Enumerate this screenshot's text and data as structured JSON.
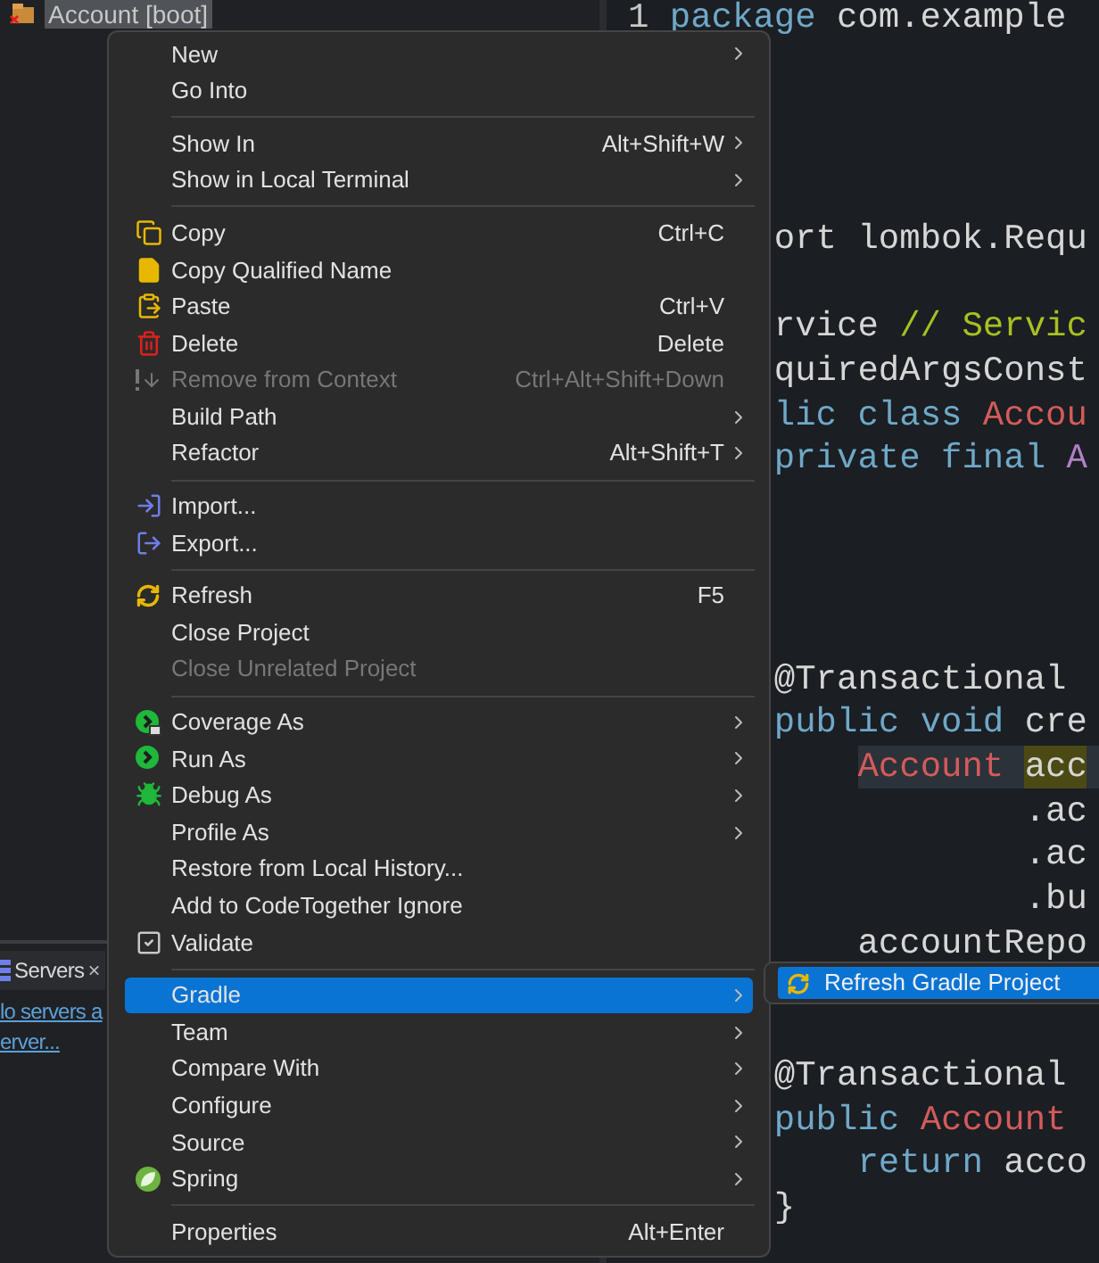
{
  "project_explorer": {
    "items": [
      {
        "label": "Account [boot]",
        "selected": true
      }
    ]
  },
  "servers_view": {
    "tab": {
      "label": "Servers",
      "close": "×"
    },
    "links": [
      "lo servers a",
      "erver..."
    ]
  },
  "editor": {
    "lines": [
      {
        "current": false,
        "segments": [
          {
            "text": "1 ",
            "kind": "linenum"
          },
          {
            "text": "package",
            "kind": "keyword"
          },
          {
            "text": " com.example",
            "kind": "plain"
          }
        ]
      },
      {
        "current": false,
        "segments": [
          {
            "text": "ort lombok.Requ",
            "kind": "plain"
          }
        ]
      },
      {
        "current": false,
        "segments": [
          {
            "text": "rvice ",
            "kind": "plain"
          },
          {
            "text": "// Servic",
            "kind": "comment"
          }
        ]
      },
      {
        "current": false,
        "segments": [
          {
            "text": "quiredArgsConst",
            "kind": "plain"
          }
        ]
      },
      {
        "current": false,
        "segments": [
          {
            "text": "lic class ",
            "kind": "keyword"
          },
          {
            "text": "Accou",
            "kind": "type"
          }
        ]
      },
      {
        "current": false,
        "segments": [
          {
            "text": "private final ",
            "kind": "keyword"
          },
          {
            "text": "A",
            "kind": "field"
          }
        ]
      },
      {
        "current": false,
        "segments": [
          {
            "text": "@Transactional",
            "kind": "plain"
          }
        ]
      },
      {
        "current": false,
        "segments": [
          {
            "text": "public void ",
            "kind": "keyword"
          },
          {
            "text": "cre",
            "kind": "plain"
          }
        ]
      },
      {
        "current": true,
        "segments": [
          {
            "text": "Account",
            "kind": "type"
          },
          {
            "text": "acc",
            "kind": "occurrence"
          }
        ]
      },
      {
        "current": false,
        "segments": [
          {
            "text": ".ac",
            "kind": "plain"
          }
        ]
      },
      {
        "current": false,
        "segments": [
          {
            "text": ".ac",
            "kind": "plain"
          }
        ]
      },
      {
        "current": false,
        "segments": [
          {
            "text": ".bu",
            "kind": "plain"
          }
        ]
      },
      {
        "current": false,
        "segments": [
          {
            "text": "accountRepo",
            "kind": "plain"
          }
        ]
      },
      {
        "current": false,
        "segments": [
          {
            "text": "@Transactional",
            "kind": "plain"
          }
        ]
      },
      {
        "current": false,
        "segments": [
          {
            "text": "public ",
            "kind": "keyword"
          },
          {
            "text": "Account",
            "kind": "type"
          }
        ]
      },
      {
        "current": false,
        "segments": [
          {
            "text": "return",
            "kind": "keyword"
          },
          {
            "text": "acco",
            "kind": "plain"
          }
        ]
      },
      {
        "current": false,
        "segments": [
          {
            "text": "}",
            "kind": "plain"
          }
        ]
      }
    ]
  },
  "context_menu": {
    "items": [
      {
        "kind": "item",
        "label": "New",
        "submenu": true,
        "disabled": false,
        "selected": false
      },
      {
        "kind": "item",
        "label": "Go Into",
        "submenu": false,
        "disabled": false,
        "selected": false
      },
      {
        "kind": "separator"
      },
      {
        "kind": "item",
        "label": "Show In",
        "shortcut": "Alt+Shift+W",
        "submenu": true,
        "disabled": false,
        "selected": false
      },
      {
        "kind": "item",
        "label": "Show in Local Terminal",
        "submenu": true,
        "disabled": false,
        "selected": false
      },
      {
        "kind": "separator"
      },
      {
        "kind": "item",
        "label": "Copy",
        "shortcut": "Ctrl+C",
        "submenu": false,
        "disabled": false,
        "selected": false
      },
      {
        "kind": "item",
        "label": "Copy Qualified Name",
        "submenu": false,
        "disabled": false,
        "selected": false
      },
      {
        "kind": "item",
        "label": "Paste",
        "shortcut": "Ctrl+V",
        "submenu": false,
        "disabled": false,
        "selected": false
      },
      {
        "kind": "item",
        "label": "Delete",
        "shortcut": "Delete",
        "submenu": false,
        "disabled": false,
        "selected": false
      },
      {
        "kind": "item",
        "label": "Remove from Context",
        "shortcut": "Ctrl+Alt+Shift+Down",
        "submenu": false,
        "disabled": true,
        "selected": false
      },
      {
        "kind": "item",
        "label": "Build Path",
        "submenu": true,
        "disabled": false,
        "selected": false
      },
      {
        "kind": "item",
        "label": "Refactor",
        "shortcut": "Alt+Shift+T",
        "submenu": true,
        "disabled": false,
        "selected": false
      },
      {
        "kind": "separator"
      },
      {
        "kind": "item",
        "label": "Import...",
        "submenu": false,
        "disabled": false,
        "selected": false
      },
      {
        "kind": "item",
        "label": "Export...",
        "submenu": false,
        "disabled": false,
        "selected": false
      },
      {
        "kind": "separator"
      },
      {
        "kind": "item",
        "label": "Refresh",
        "shortcut": "F5",
        "submenu": false,
        "disabled": false,
        "selected": false
      },
      {
        "kind": "item",
        "label": "Close Project",
        "submenu": false,
        "disabled": false,
        "selected": false
      },
      {
        "kind": "item",
        "label": "Close Unrelated Project",
        "submenu": false,
        "disabled": true,
        "selected": false
      },
      {
        "kind": "separator"
      },
      {
        "kind": "item",
        "label": "Coverage As",
        "submenu": true,
        "disabled": false,
        "selected": false
      },
      {
        "kind": "item",
        "label": "Run As",
        "submenu": true,
        "disabled": false,
        "selected": false
      },
      {
        "kind": "item",
        "label": "Debug As",
        "submenu": true,
        "disabled": false,
        "selected": false
      },
      {
        "kind": "item",
        "label": "Profile As",
        "submenu": true,
        "disabled": false,
        "selected": false
      },
      {
        "kind": "item",
        "label": "Restore from Local History...",
        "submenu": false,
        "disabled": false,
        "selected": false
      },
      {
        "kind": "item",
        "label": "Add to CodeTogether Ignore",
        "submenu": false,
        "disabled": false,
        "selected": false
      },
      {
        "kind": "item",
        "label": "Validate",
        "submenu": false,
        "disabled": false,
        "selected": false
      },
      {
        "kind": "separator"
      },
      {
        "kind": "item",
        "label": "Gradle",
        "submenu": true,
        "disabled": false,
        "selected": true
      },
      {
        "kind": "item",
        "label": "Team",
        "submenu": true,
        "disabled": false,
        "selected": false
      },
      {
        "kind": "item",
        "label": "Compare With",
        "submenu": true,
        "disabled": false,
        "selected": false
      },
      {
        "kind": "item",
        "label": "Configure",
        "submenu": true,
        "disabled": false,
        "selected": false
      },
      {
        "kind": "item",
        "label": "Source",
        "submenu": true,
        "disabled": false,
        "selected": false
      },
      {
        "kind": "item",
        "label": "Spring",
        "submenu": true,
        "disabled": false,
        "selected": false
      },
      {
        "kind": "separator"
      },
      {
        "kind": "item",
        "label": "Properties",
        "shortcut": "Alt+Enter",
        "submenu": false,
        "disabled": false,
        "selected": false
      }
    ]
  },
  "submenu": {
    "items": [
      {
        "label": "Refresh Gradle Project",
        "selected": true
      }
    ]
  }
}
